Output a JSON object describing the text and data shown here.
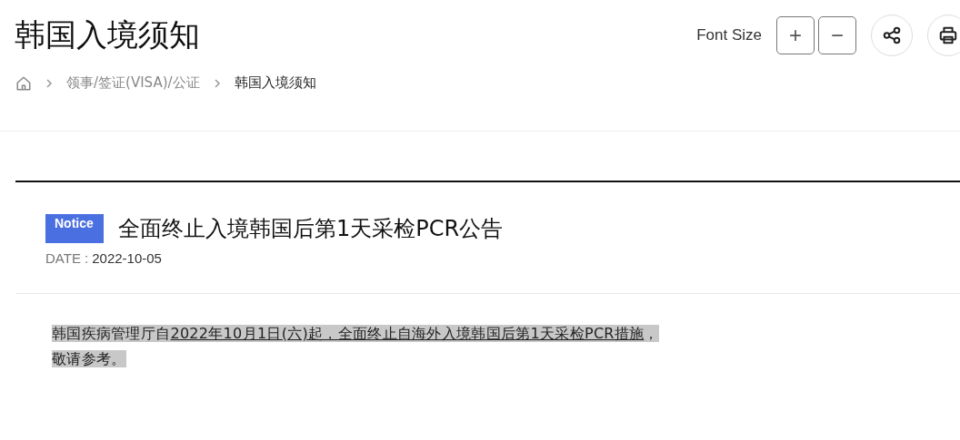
{
  "page_title": "韩国入境须知",
  "font_size": {
    "label": "Font Size",
    "increase": "+",
    "decrease": "−"
  },
  "breadcrumb": [
    {
      "label": "领事/签证(VISA)/公证",
      "current": false
    },
    {
      "label": "韩国入境须知",
      "current": true
    }
  ],
  "notice": {
    "badge": "Notice",
    "title": "全面终止入境韩国后第1天采检PCR公告",
    "date_label": "DATE :",
    "date": "2022-10-05"
  },
  "body": {
    "lead": "韩国疾病管理厅自",
    "underlined": "2022年10月1日(六)起，全面终止自海外入境韩国后第1天采检PCR措施",
    "punct": "，",
    "tail": "敬请参考。"
  }
}
